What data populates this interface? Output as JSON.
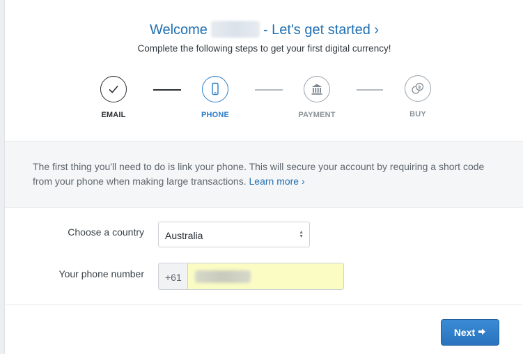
{
  "header": {
    "welcome": "Welcome",
    "lets_get_started": "- Let's get started ›",
    "subtitle": "Complete the following steps to get your first digital currency!"
  },
  "steps": [
    {
      "label": "EMAIL",
      "status": "done",
      "icon": "checkmark-icon"
    },
    {
      "label": "PHONE",
      "status": "active",
      "icon": "phone-icon"
    },
    {
      "label": "PAYMENT",
      "status": "todo",
      "icon": "bank-icon"
    },
    {
      "label": "BUY",
      "status": "todo",
      "icon": "coins-icon"
    }
  ],
  "info": {
    "text": "The first thing you'll need to do is link your phone. This will secure your account by requiring a short code from your phone when making large transactions.",
    "learn_more": "Learn more ›"
  },
  "form": {
    "country_label": "Choose a country",
    "country_value": "Australia",
    "phone_label": "Your phone number",
    "phone_prefix": "+61"
  },
  "actions": {
    "next_label": "Next",
    "next_icon": "arrow-right-icon"
  },
  "colors": {
    "accent": "#2e7cc7",
    "heading": "#1f6fb2",
    "autofill": "#fbfcc4"
  }
}
